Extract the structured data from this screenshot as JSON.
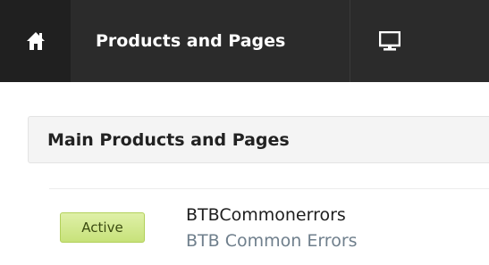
{
  "nav": {
    "home_icon": "home-icon",
    "link_label": "Products and Pages",
    "preview_icon": "monitor-icon"
  },
  "section": {
    "title": "Main Products and Pages"
  },
  "products": [
    {
      "status": "Active",
      "name": "BTBCommonerrors",
      "subtitle": "BTB Common Errors"
    }
  ],
  "colors": {
    "topbar": "#2b2b2b",
    "home_cell": "#202020",
    "badge_green": "#c7e27a",
    "subtitle_text": "#6f7f8c"
  }
}
